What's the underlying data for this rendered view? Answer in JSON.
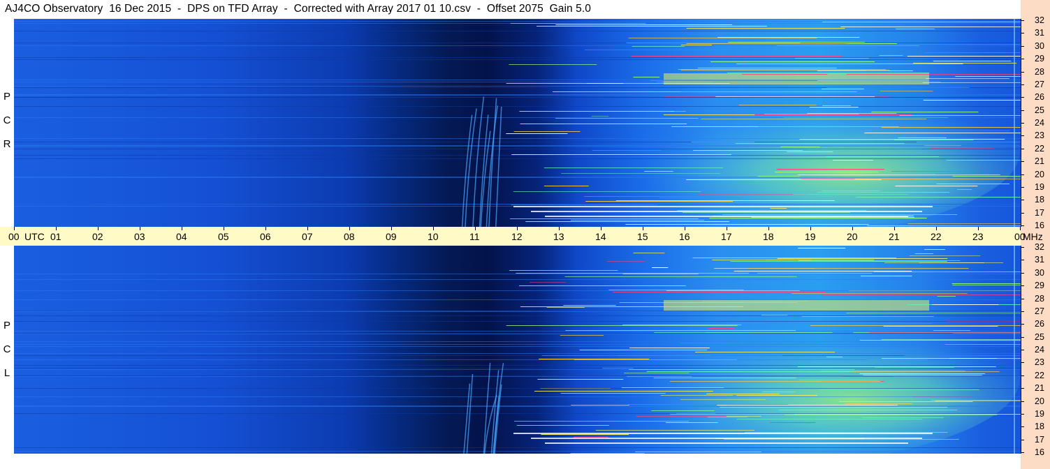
{
  "title": "AJ4CO Observatory  16 Dec 2015  -  DPS on TFD Array  -  Corrected with Array 2017 01 10.csv  -  Offset 2075  Gain 5.0",
  "panels": [
    {
      "id": "rcp",
      "label_letters": [
        "R",
        "C",
        "P"
      ]
    },
    {
      "id": "lcp",
      "label_letters": [
        "L",
        "C",
        "P"
      ]
    }
  ],
  "chart_data": [
    {
      "type": "heatmap",
      "name": "RCP",
      "x_axis": {
        "labels": [
          "00",
          "UTC",
          "01",
          "02",
          "03",
          "04",
          "05",
          "06",
          "07",
          "08",
          "09",
          "10",
          "11",
          "12",
          "13",
          "14",
          "15",
          "16",
          "17",
          "18",
          "19",
          "20",
          "21",
          "22",
          "23",
          "00",
          "MHz"
        ],
        "range_hours": [
          0,
          24
        ]
      },
      "y_axis": {
        "ticks": [
          32,
          31,
          30,
          29,
          28,
          27,
          26,
          25,
          24,
          23,
          22,
          21,
          20,
          19,
          18,
          17,
          16
        ],
        "range_mhz": [
          16,
          32
        ]
      }
    },
    {
      "type": "heatmap",
      "name": "LCP",
      "x_axis": {
        "labels": [
          "00",
          "UTC",
          "01",
          "02",
          "03",
          "04",
          "05",
          "06",
          "07",
          "08",
          "09",
          "10",
          "11",
          "12",
          "13",
          "14",
          "15",
          "16",
          "17",
          "18",
          "19",
          "20",
          "21",
          "22",
          "23",
          "00",
          "MHz"
        ],
        "range_hours": [
          0,
          24
        ]
      },
      "y_axis": {
        "ticks": [
          32,
          31,
          30,
          29,
          28,
          27,
          26,
          25,
          24,
          23,
          22,
          21,
          20,
          19,
          18,
          17,
          16
        ],
        "range_mhz": [
          16,
          32
        ]
      }
    }
  ]
}
